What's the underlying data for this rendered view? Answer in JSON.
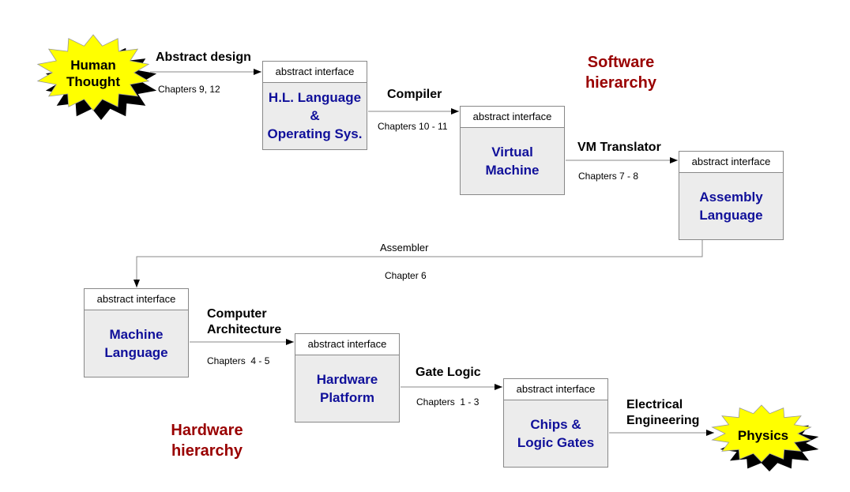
{
  "colors": {
    "box_text": "#10109a",
    "hierarchy_text": "#990000",
    "star_fill": "#ffff00",
    "star_shadow": "#000000"
  },
  "stars": {
    "human": "Human\nThought",
    "physics": "Physics"
  },
  "headers": {
    "software": "Software\nhierarchy",
    "hardware": "Hardware\nhierarchy"
  },
  "interface_label": "abstract interface",
  "boxes": [
    {
      "title": "H.L. Language\n&\nOperating Sys."
    },
    {
      "title": "Virtual\nMachine"
    },
    {
      "title": "Assembly\nLanguage"
    },
    {
      "title": "Machine\nLanguage"
    },
    {
      "title": "Hardware\nPlatform"
    },
    {
      "title": "Chips &\nLogic Gates"
    }
  ],
  "transitions": [
    {
      "label": "Abstract design",
      "chapters": "Chapters 9, 12"
    },
    {
      "label": "Compiler",
      "chapters": "Chapters 10 - 11"
    },
    {
      "label": "VM Translator",
      "chapters": "Chapters 7 - 8"
    },
    {
      "label": "Assembler",
      "chapters": "Chapter 6"
    },
    {
      "label": "Computer\nArchitecture",
      "chapters": "Chapters  4 - 5"
    },
    {
      "label": "Gate Logic",
      "chapters": "Chapters  1 - 3"
    },
    {
      "label": "Electrical\nEngineering",
      "chapters": ""
    }
  ]
}
